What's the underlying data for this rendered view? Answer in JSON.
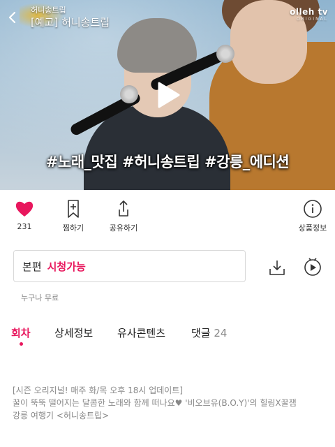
{
  "video": {
    "channel": "허니송트립",
    "title": "[예고] 허니송트립",
    "brand_main": "olleh tv",
    "brand_sub": "ORIGINAL",
    "hashtags": "#노래_맛집 #허니송트립 #강릉_에디션"
  },
  "actions": {
    "like_count": "231",
    "save_label": "찜하기",
    "share_label": "공유하기",
    "info_label": "상품정보"
  },
  "episode": {
    "kind": "본편",
    "status": "시청가능",
    "free_note": "누구나 무료"
  },
  "tabs": [
    {
      "label": "회차",
      "count": ""
    },
    {
      "label": "상세정보",
      "count": ""
    },
    {
      "label": "유사콘텐츠",
      "count": ""
    },
    {
      "label": "댓글",
      "count": "24"
    }
  ],
  "description": {
    "line1": "[시즌 오리지널! 매주 화/목 오후 18시 업데이트]",
    "line2": "꿀이 뚝뚝 떨어지는 달콤한 노래와 함께 떠나요♥ '비오브유(B.O.Y)'의 힐링X꿀잼",
    "line3": "강릉 여행기 <허니송트립>"
  },
  "colors": {
    "accent": "#e8175d",
    "muted_text": "#888888",
    "border": "#d9d9d9"
  },
  "icons": {
    "back": "chevron-left-icon",
    "play": "play-icon",
    "like": "heart-icon",
    "save": "bookmark-plus-icon",
    "share": "share-icon",
    "info": "info-icon",
    "download": "download-icon",
    "tv": "tv-play-icon"
  }
}
